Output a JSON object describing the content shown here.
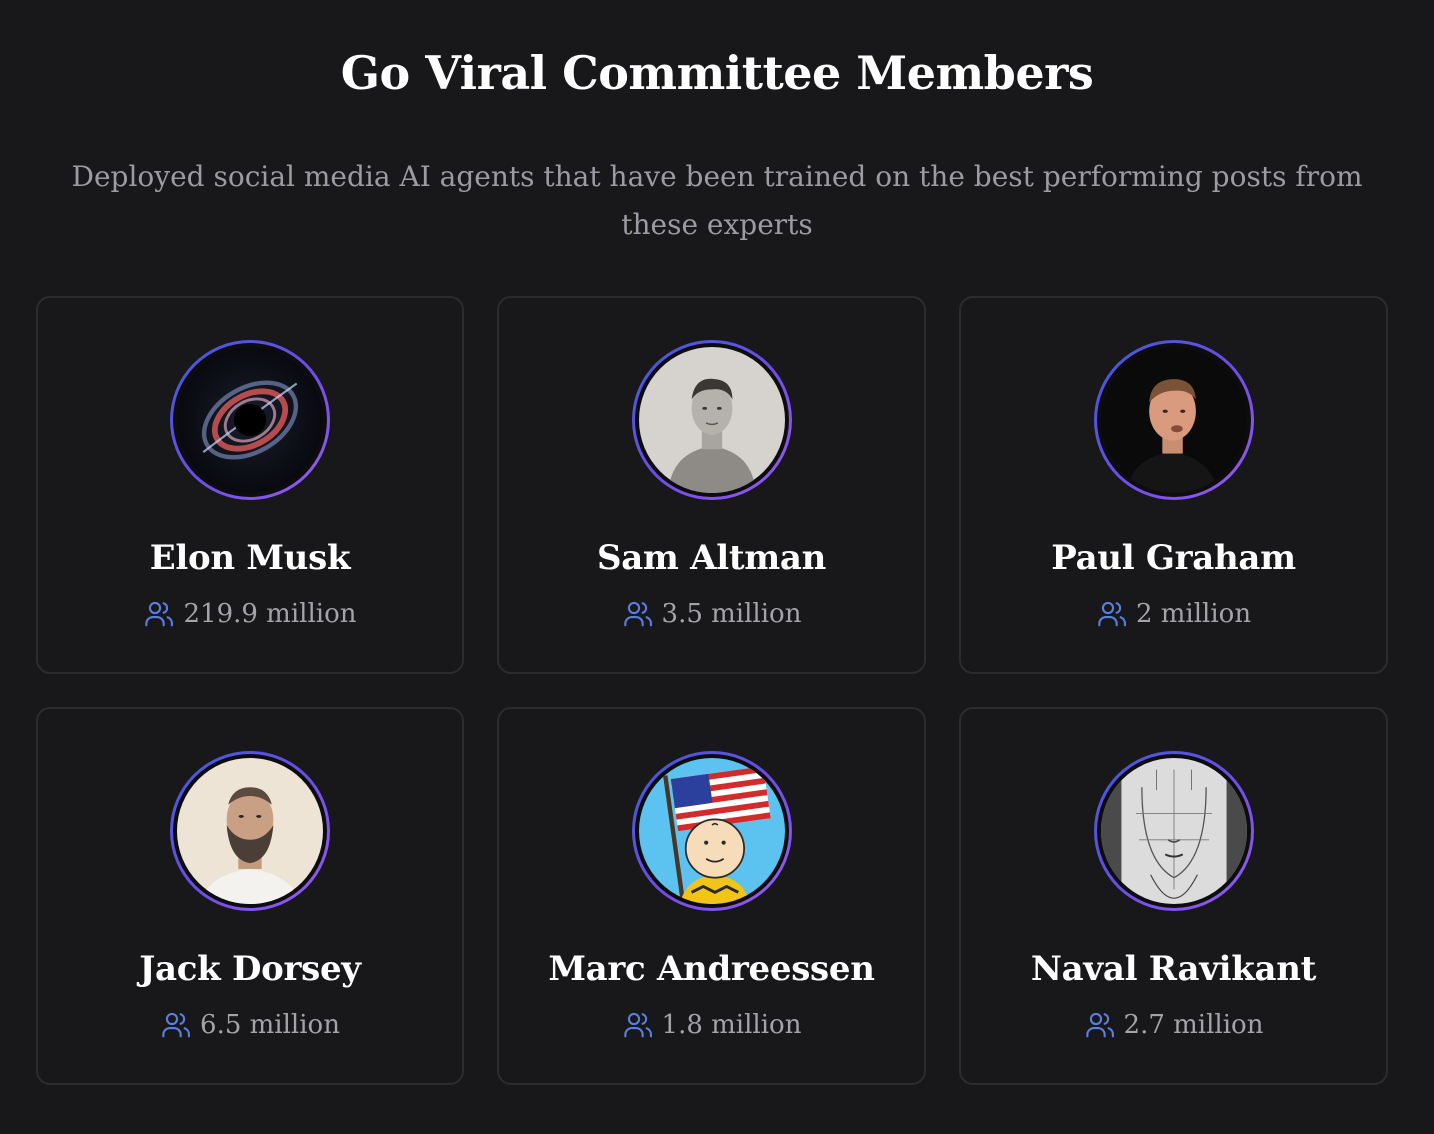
{
  "header": {
    "title": "Go Viral Committee Members",
    "subtitle": "Deployed social media AI agents that have been trained on the best performing posts from these experts"
  },
  "accent_color": "#6b4de6",
  "icon_color": "#5b7fe0",
  "members": [
    {
      "name": "Elon Musk",
      "followers": "219.9 million",
      "avatar": "black-hole-image"
    },
    {
      "name": "Sam Altman",
      "followers": "3.5 million",
      "avatar": "sketch-portrait-photo"
    },
    {
      "name": "Paul Graham",
      "followers": "2 million",
      "avatar": "portrait-photo"
    },
    {
      "name": "Jack Dorsey",
      "followers": "6.5 million",
      "avatar": "bearded-portrait-photo"
    },
    {
      "name": "Marc Andreessen",
      "followers": "1.8 million",
      "avatar": "cartoon-flag-image"
    },
    {
      "name": "Naval Ravikant",
      "followers": "2.7 million",
      "avatar": "pencil-sketch-face"
    }
  ]
}
